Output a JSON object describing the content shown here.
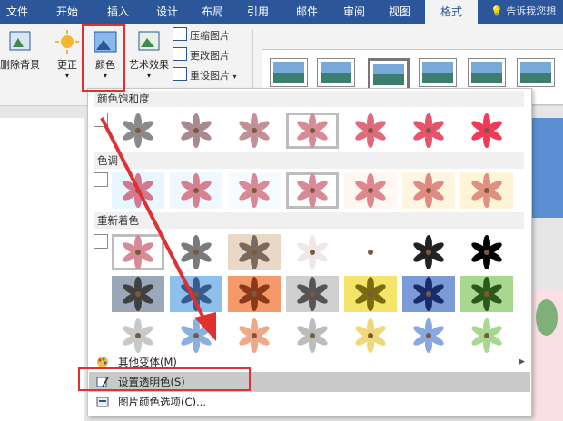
{
  "tabs": [
    "文件",
    "开始",
    "插入",
    "设计",
    "布局",
    "引用",
    "邮件",
    "审阅",
    "视图",
    "格式"
  ],
  "active_tab": "格式",
  "tell_me": "告诉我您想",
  "ribbon": {
    "remove_background": "删除背景",
    "corrections": "更正",
    "color": "颜色",
    "artistic_effects": "艺术效果",
    "compress": "压缩图片",
    "change": "更改图片",
    "reset": "重设图片"
  },
  "menu": {
    "saturation_title": "颜色饱和度",
    "tone_title": "色调",
    "recolor_title": "重新着色",
    "more_variations": "其他变体(M)",
    "set_transparent": "设置透明色(S)",
    "color_options": "图片颜色选项(C)..."
  },
  "colors": {
    "tabbar": "#2b579a",
    "annotation": "#e03030",
    "highlight": "#c9c9c9"
  },
  "saturation": [
    {
      "bg": "#ffffff",
      "c": "#8a8a8a"
    },
    {
      "bg": "#ffffff",
      "c": "#a98a8e"
    },
    {
      "bg": "#ffffff",
      "c": "#c49098"
    },
    {
      "bg": "#ffffff",
      "c": "#d88a96",
      "sel": true
    },
    {
      "bg": "#ffffff",
      "c": "#e06a7c"
    },
    {
      "bg": "#ffffff",
      "c": "#e8526a"
    },
    {
      "bg": "#ffffff",
      "c": "#f03a58"
    }
  ],
  "tone": [
    {
      "bg": "#e8f6ff",
      "c": "#d07a90"
    },
    {
      "bg": "#f0f8ff",
      "c": "#d88090"
    },
    {
      "bg": "#f6fbff",
      "c": "#d88a96"
    },
    {
      "bg": "#ffffff",
      "c": "#d88a96",
      "sel": true
    },
    {
      "bg": "#fff8f2",
      "c": "#e0868e"
    },
    {
      "bg": "#fff5e0",
      "c": "#e08a86"
    },
    {
      "bg": "#fff4d8",
      "c": "#e09080"
    }
  ],
  "recolor_row1": [
    {
      "bg": "#ffffff",
      "c": "#d88a96",
      "sel": true
    },
    {
      "bg": "#ffffff",
      "c": "#7a7a7a"
    },
    {
      "bg": "#ead8c6",
      "c": "#7a6a5e"
    },
    {
      "bg": "#ffffff",
      "c": "#f0e8e8"
    },
    {
      "bg": "#ffffff",
      "c": "#ffffff"
    },
    {
      "bg": "#ffffff",
      "c": "#222222"
    },
    {
      "bg": "#ffffff",
      "c": "#000000"
    }
  ],
  "recolor_row2": [
    {
      "bg": "#9aa8ba",
      "c": "#404040"
    },
    {
      "bg": "#8ec0ee",
      "c": "#3a5a8a"
    },
    {
      "bg": "#f49a6a",
      "c": "#8a3a1a"
    },
    {
      "bg": "#cfcfcf",
      "c": "#555555"
    },
    {
      "bg": "#f4e46a",
      "c": "#7a6a10"
    },
    {
      "bg": "#7a9ad8",
      "c": "#1a2a6a"
    },
    {
      "bg": "#a8d890",
      "c": "#2a5a1a"
    }
  ],
  "recolor_row3": [
    {
      "bg": "#ffffff",
      "c": "#c8c8c8"
    },
    {
      "bg": "#ffffff",
      "c": "#8ab0e0"
    },
    {
      "bg": "#ffffff",
      "c": "#f0a888"
    },
    {
      "bg": "#ffffff",
      "c": "#bcbcbc"
    },
    {
      "bg": "#ffffff",
      "c": "#f0d878"
    },
    {
      "bg": "#ffffff",
      "c": "#8aa8e0"
    },
    {
      "bg": "#ffffff",
      "c": "#a8d890"
    }
  ]
}
